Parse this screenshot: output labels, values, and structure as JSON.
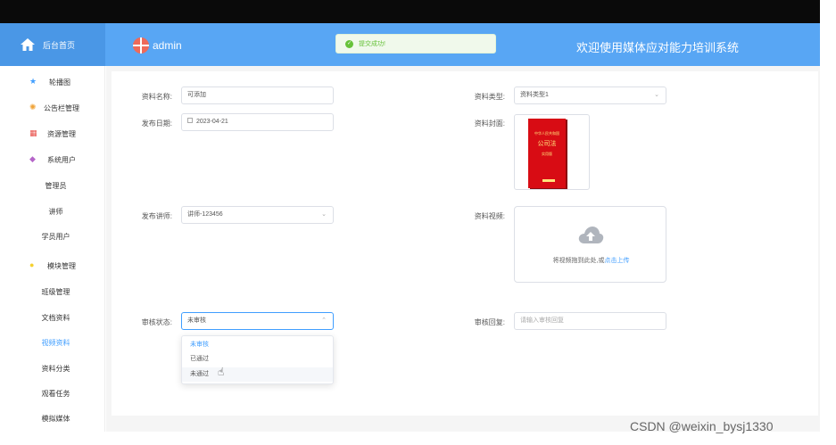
{
  "header": {
    "home_label": "后台首页",
    "user": "admin",
    "toast": "提交成功!",
    "system_title": "欢迎使用媒体应对能力培训系统"
  },
  "sidebar": {
    "items": [
      {
        "label": "轮播图",
        "icon": "star-icon"
      },
      {
        "label": "公告栏管理",
        "icon": "gear-icon"
      },
      {
        "label": "资源管理",
        "icon": "grid-icon"
      },
      {
        "label": "系统用户",
        "icon": "user-icon"
      },
      {
        "label": "管理员"
      },
      {
        "label": "讲师"
      },
      {
        "label": "学员用户"
      },
      {
        "label": "模块管理",
        "icon": "circle-icon"
      },
      {
        "label": "班级管理"
      },
      {
        "label": "文档资料"
      },
      {
        "label": "视频资料"
      },
      {
        "label": "资料分类"
      },
      {
        "label": "观看任务"
      },
      {
        "label": "模拟媒体"
      }
    ],
    "active": "视频资料"
  },
  "form": {
    "name_label": "资料名称:",
    "name_value": "可添加",
    "type_label": "资料类型:",
    "type_value": "资料类型1",
    "date_label": "发布日期:",
    "date_value": "2023-04-21",
    "cover_label": "资料封面:",
    "teacher_label": "发布讲师:",
    "teacher_value": "讲师-123456",
    "video_label": "资料视频:",
    "upload_text": "将视频拖到此处,或",
    "upload_link": "点击上传",
    "status_label": "审核状态:",
    "status_value": "未审核",
    "reply_label": "审核回复:",
    "reply_placeholder": "请输入审核回复",
    "status_options": [
      "未审核",
      "已通过",
      "未通过"
    ]
  },
  "cover_book": {
    "top": "中华人民共和国",
    "title": "公司法",
    "edition": "实用版"
  },
  "watermark": "CSDN @weixin_bysj1330",
  "colors": {
    "header": "#58a6f4",
    "accent": "#409eff",
    "success": "#67c23a"
  }
}
